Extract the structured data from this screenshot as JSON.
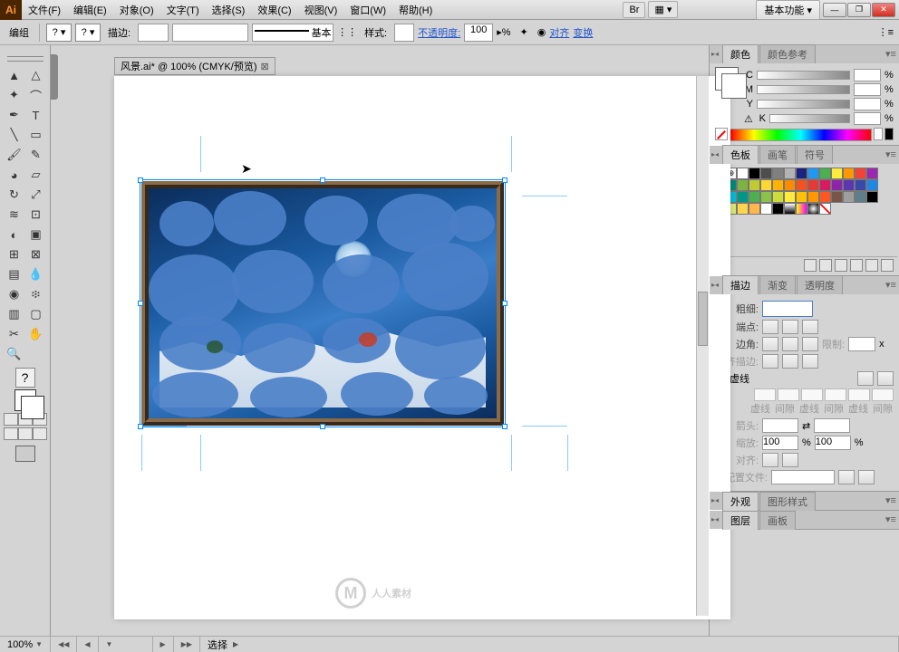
{
  "app": {
    "logo": "Ai",
    "workspace": "基本功能"
  },
  "menu": {
    "file": "文件(F)",
    "edit": "编辑(E)",
    "object": "对象(O)",
    "type": "文字(T)",
    "select": "选择(S)",
    "effect": "效果(C)",
    "view": "视图(V)",
    "window": "窗口(W)",
    "help": "帮助(H)"
  },
  "br_button": "Br",
  "optbar": {
    "mode": "编组",
    "stroke": "描边:",
    "style": "样式:",
    "stroke_basic": "基本",
    "opacity_label": "不透明度:",
    "opacity_value": "100",
    "opacity_pct": "%",
    "align": "对齐",
    "transform": "变换"
  },
  "document_tab": "风景.ai* @ 100% (CMYK/预览)",
  "panels": {
    "color": {
      "tab1": "颜色",
      "tab2": "颜色参考",
      "c": "C",
      "m": "M",
      "y": "Y",
      "k": "K",
      "pct": "%"
    },
    "swatches": {
      "tab1": "色板",
      "tab2": "画笔",
      "tab3": "符号"
    },
    "stroke": {
      "tab1": "描边",
      "tab2": "渐变",
      "tab3": "透明度",
      "weight": "粗细:",
      "cap": "端点:",
      "join": "边角:",
      "limit": "限制:",
      "limit_x": "x",
      "align_stroke": "对齐描边:",
      "dash": "虚线",
      "dashlabels": [
        "虚线",
        "间隙",
        "虚线",
        "间隙",
        "虚线",
        "间隙"
      ],
      "arrow": "箭头:",
      "scale": "缩放:",
      "scale_val": "100",
      "pct": "%",
      "align2": "对齐:",
      "profile": "配置文件:"
    },
    "appearance": {
      "tab1": "外观",
      "tab2": "图形样式"
    },
    "layers": {
      "tab1": "图层",
      "tab2": "画板"
    }
  },
  "status": {
    "zoom": "100%",
    "tool_label": "选择"
  },
  "watermark": "人人素材",
  "swatch_colors": [
    "none",
    "reg",
    "#ffffff",
    "#000000",
    "#4d4d4d",
    "#808080",
    "#b3b3b3",
    "#1a237e",
    "#2196f3",
    "#4caf50",
    "#ffeb3b",
    "#ff9800",
    "#f44336",
    "#9c27b0",
    "#006064",
    "#00897b",
    "#7cb342",
    "#c0ca33",
    "#fdd835",
    "#ffb300",
    "#fb8c00",
    "#f4511e",
    "#e53935",
    "#d81b60",
    "#8e24aa",
    "#5e35b1",
    "#3949ab",
    "#1e88e5",
    "#03a9f4",
    "#00bcd4",
    "#009688",
    "#4caf50",
    "#8bc34a",
    "#cddc39",
    "#ffeb3b",
    "#ffc107",
    "#ff9800",
    "#ff5722",
    "#795548",
    "#9e9e9e",
    "#607d8b",
    "#000000",
    "#26c6da",
    "#dce775",
    "#ffd54f",
    "#ffb74d",
    "#ffffff",
    "#000000",
    "grad",
    "grad2",
    "rad",
    "none2"
  ]
}
